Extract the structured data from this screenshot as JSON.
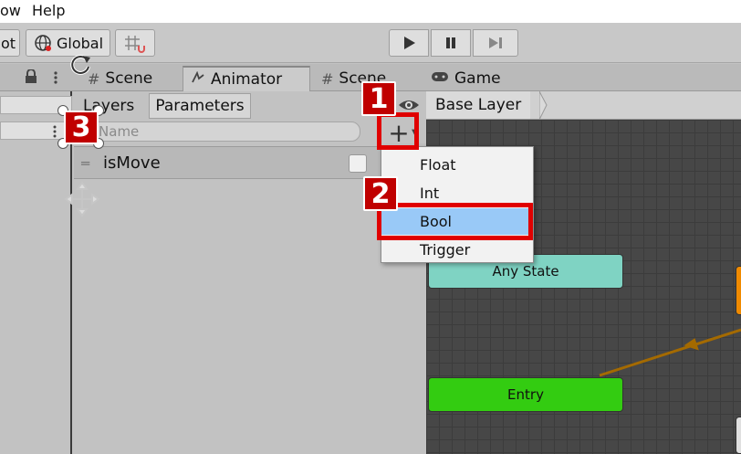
{
  "menu": {
    "items": [
      "ow",
      "Help"
    ]
  },
  "toolbar": {
    "pivot_label": "ot",
    "global_label": "Global",
    "snap_icon": "grid-snap-icon",
    "play_icon": "play-icon",
    "pause_icon": "pause-icon",
    "step_icon": "step-icon"
  },
  "tabs": [
    {
      "label": "Scene",
      "icon": "scene-icon"
    },
    {
      "label": "Animator",
      "icon": "animator-icon",
      "active": true
    },
    {
      "label": "Scene",
      "icon": "scene-icon"
    },
    {
      "label": "Game",
      "icon": "gamepad-icon"
    }
  ],
  "animator": {
    "subtabs": [
      "Layers",
      "Parameters"
    ],
    "search_placeholder": "Name",
    "parameters": [
      {
        "name": "isMove",
        "type": "bool",
        "value": false
      }
    ],
    "breadcrumb": "Base Layer"
  },
  "dropdown": {
    "items": [
      "Float",
      "Int",
      "Bool",
      "Trigger"
    ],
    "selected": "Bool"
  },
  "graph": {
    "nodes": [
      {
        "label": "Any State",
        "color": "#7fd3c3"
      },
      {
        "label": "Entry",
        "color": "#33cc11"
      }
    ]
  },
  "annotations": {
    "badge1": "1",
    "badge2": "2",
    "badge3": "3"
  },
  "colors": {
    "highlight": "#e00000",
    "selection": "#99c9f7",
    "entry": "#33cc11",
    "any_state": "#7fd3c3",
    "orange_node": "#f08a00"
  }
}
